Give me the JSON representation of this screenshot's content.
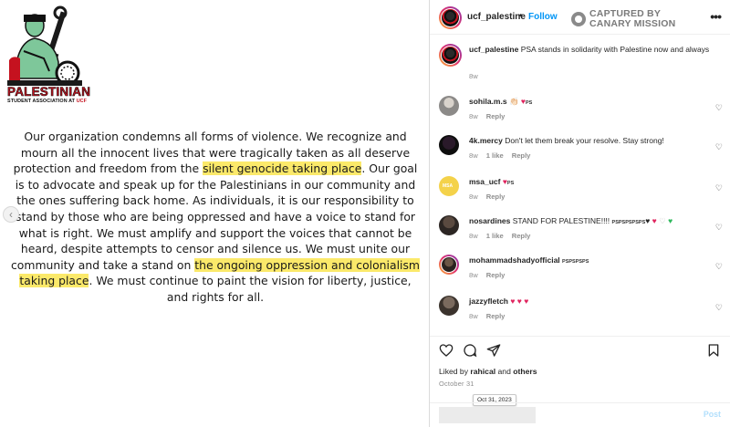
{
  "post_image": {
    "logo": {
      "main_text": "PALESTINIAN",
      "sub_text_prefix": "STUDENT ASSOCIATION AT",
      "sub_text_suffix": "UCF"
    },
    "statement": {
      "part1": "Our organization condemns all forms of violence. We recognize and mourn all the innocent lives that were tragically taken as all deserve protection and freedom from the ",
      "highlight1": "silent genocide taking place",
      "part2": ". Our goal is to advocate and speak up for the Palestinians in our community and the ones suffering back home. As individuals, it is our responsibility to stand by those who are being oppressed and have a voice to stand for what is right. We must amplify and support the voices that cannot be heard, despite attempts to censor and silence us. We must unite our community and take a stand on ",
      "highlight2": "the ongoing oppression and colonialism taking place",
      "part3": ". We must continue to paint the vision for liberty, justice, and rights for all."
    },
    "prev_arrow": "‹"
  },
  "header": {
    "username": "ucf_palestine",
    "dot": "•",
    "follow": "Follow",
    "watermark_line1": "CAPTURED BY",
    "watermark_line2": "CANARY MISSION",
    "more": "•••"
  },
  "caption": {
    "username": "ucf_palestine",
    "text": "PSA stands in solidarity with Palestine now and always",
    "time": "8w"
  },
  "comments": [
    {
      "username": "sohila.m.s",
      "text": "👏🏻",
      "flag": "PS",
      "time": "8w",
      "likes": "",
      "reply": "Reply"
    },
    {
      "username": "4k.mercy",
      "text": "Don't let them break your resolve. Stay strong!",
      "flag": "",
      "time": "8w",
      "likes": "1 like",
      "reply": "Reply"
    },
    {
      "username": "msa_ucf",
      "text": "",
      "flag": "PS",
      "time": "8w",
      "likes": "",
      "reply": "Reply"
    },
    {
      "username": "nosardines",
      "text": "STAND FOR PALESTINE!!!!",
      "flag": "PSPSPSPSPS",
      "time": "8w",
      "likes": "1 like",
      "reply": "Reply"
    },
    {
      "username": "mohammadshadyofficial",
      "text": "",
      "flag": "PSPSPSPS",
      "time": "8w",
      "likes": "",
      "reply": "Reply"
    },
    {
      "username": "jazzyfletch",
      "text": "",
      "flag": "",
      "time": "8w",
      "likes": "",
      "reply": "Reply"
    }
  ],
  "likes": {
    "prefix": "Liked by",
    "user": "rahical",
    "middle": "and",
    "others": "others"
  },
  "date": "October 31",
  "tooltip": "Oct 31, 2023",
  "comment_input": {
    "placeholder": ""
  },
  "post_button": "Post",
  "colors": {
    "accent": "#0095f6",
    "highlight": "#fbe96a",
    "heart": "#e0245e",
    "logo_red": "#c5121f"
  }
}
